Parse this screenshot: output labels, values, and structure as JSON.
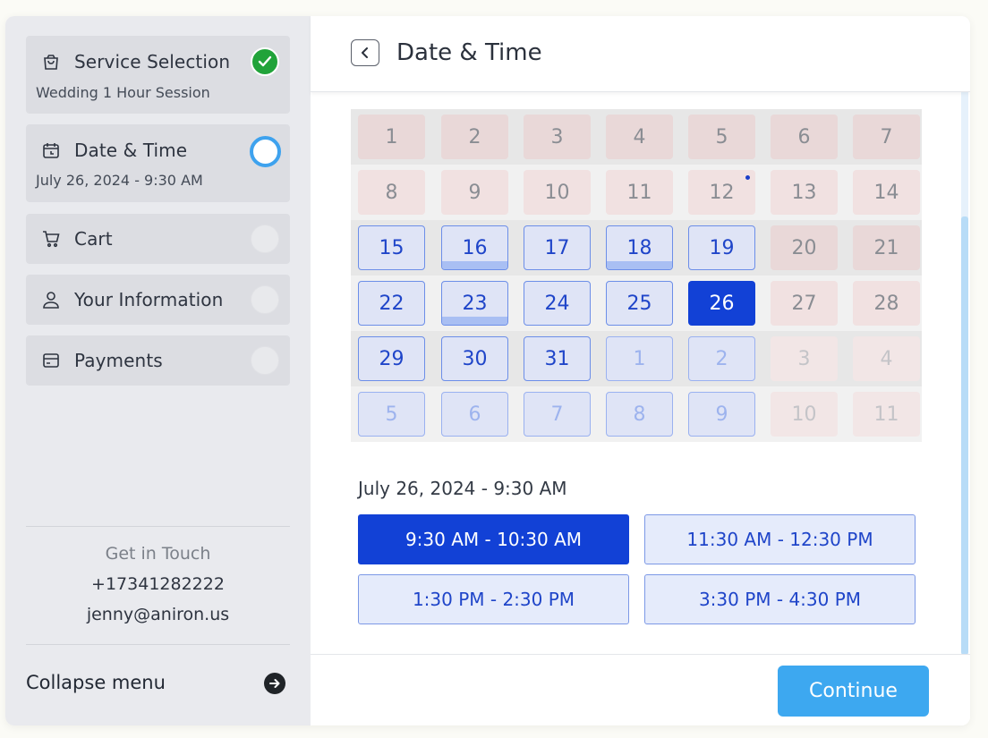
{
  "sidebar": {
    "steps": [
      {
        "title": "Service Selection",
        "subtitle": "Wedding 1 Hour Session",
        "status": "completed",
        "icon": "shopping-bag-icon"
      },
      {
        "title": "Date & Time",
        "subtitle": "July 26, 2024 - 9:30 AM",
        "status": "current",
        "icon": "calendar-icon"
      },
      {
        "title": "Cart",
        "status": "pending",
        "icon": "cart-icon"
      },
      {
        "title": "Your Information",
        "status": "pending",
        "icon": "user-icon"
      },
      {
        "title": "Payments",
        "status": "pending",
        "icon": "credit-card-icon"
      }
    ],
    "contact": {
      "heading": "Get in Touch",
      "phone": "+17341282222",
      "email": "jenny@aniron.us"
    },
    "collapse_label": "Collapse menu"
  },
  "header": {
    "title": "Date & Time"
  },
  "calendar": {
    "weeks": [
      [
        "1",
        "2",
        "3",
        "4",
        "5",
        "6",
        "7"
      ],
      [
        "8",
        "9",
        "10",
        "11",
        "12",
        "13",
        "14"
      ],
      [
        "15",
        "16",
        "17",
        "18",
        "19",
        "20",
        "21"
      ],
      [
        "22",
        "23",
        "24",
        "25",
        "26",
        "27",
        "28"
      ],
      [
        "29",
        "30",
        "31",
        "1",
        "2",
        "3",
        "4"
      ],
      [
        "5",
        "6",
        "7",
        "8",
        "9",
        "10",
        "11"
      ]
    ],
    "selected_day": "26"
  },
  "selected_datetime": "July 26, 2024 - 9:30 AM",
  "time_slots": [
    {
      "label": "9:30 AM - 10:30 AM",
      "selected": true
    },
    {
      "label": "11:30 AM - 12:30 PM",
      "selected": false
    },
    {
      "label": "1:30 PM - 2:30 PM",
      "selected": false
    },
    {
      "label": "3:30 PM - 4:30 PM",
      "selected": false
    }
  ],
  "footer": {
    "continue_label": "Continue"
  },
  "colors": {
    "accent": "#1241d6",
    "continue": "#3da8f0",
    "completed": "#21a33a",
    "current_ring": "#3ea2ee"
  }
}
